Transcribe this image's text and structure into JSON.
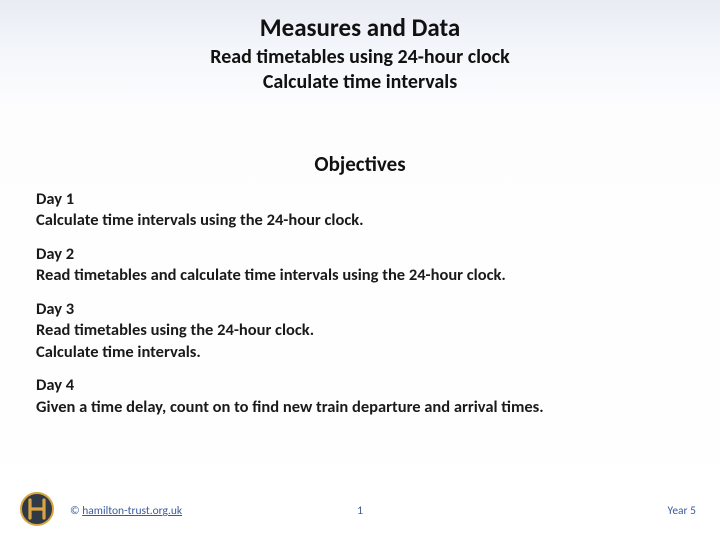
{
  "title": "Measures and Data",
  "subtitle_line1": "Read timetables using 24-hour clock",
  "subtitle_line2": "Calculate time intervals",
  "objectives_heading": "Objectives",
  "objectives": [
    {
      "day": "Day 1",
      "lines": [
        "Calculate time intervals using the 24-hour clock."
      ]
    },
    {
      "day": "Day 2",
      "lines": [
        "Read timetables and calculate time intervals using the 24-hour clock."
      ]
    },
    {
      "day": "Day 3",
      "lines": [
        "Read timetables using the 24-hour clock.",
        "Calculate time intervals."
      ]
    },
    {
      "day": "Day 4",
      "lines": [
        "Given a time delay, count on to find new train departure and arrival times."
      ]
    }
  ],
  "footer": {
    "copyright_prefix": "© ",
    "copyright_link": "hamilton-trust.org.uk",
    "page_number": "1",
    "year_label": "Year 5"
  }
}
